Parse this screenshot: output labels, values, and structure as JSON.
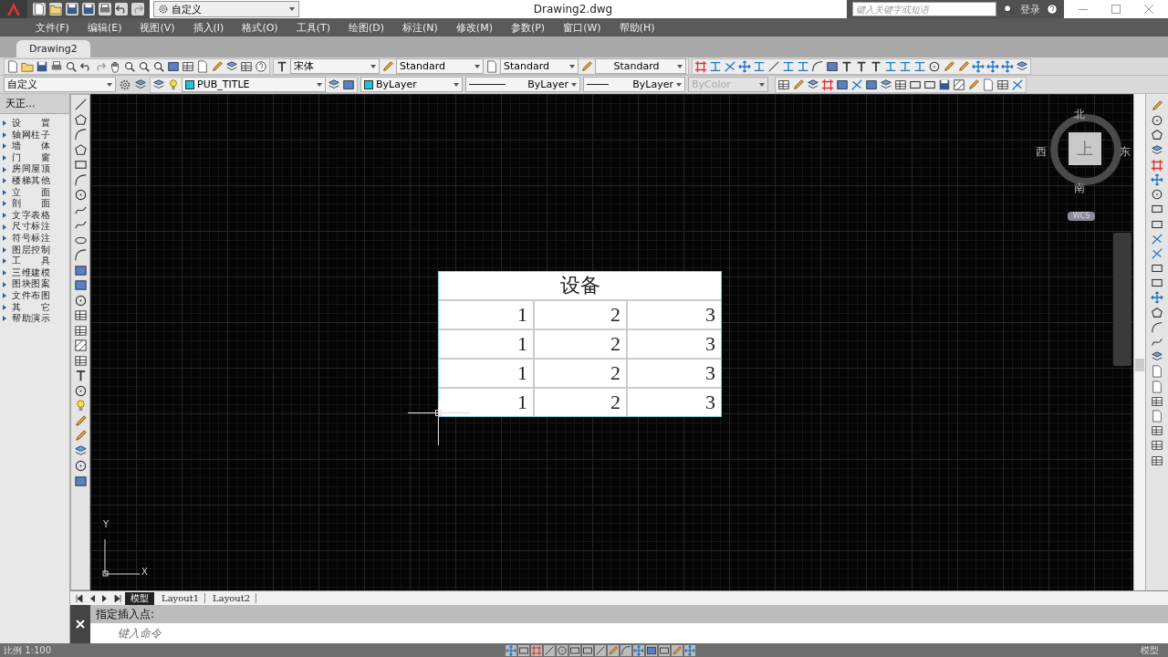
{
  "title_bar": {
    "workspace": "自定义",
    "title": "Drawing2.dwg",
    "search": {
      "placeholder": "键入关键字或短语"
    },
    "sign_in": "登录"
  },
  "menu": [
    "文件(F)",
    "编辑(E)",
    "视图(V)",
    "插入(I)",
    "格式(O)",
    "工具(T)",
    "绘图(D)",
    "标注(N)",
    "修改(M)",
    "参数(P)",
    "窗口(W)",
    "帮助(H)"
  ],
  "document_tabs": [
    {
      "label": "Drawing2",
      "selected": true
    }
  ],
  "toolbar": {
    "font": "宋体",
    "text_style": "Standard",
    "dim_style": "Standard",
    "table_style": "Standard"
  },
  "properties_bar": {
    "workspace": "自定义",
    "layer": "PUB_TITLE",
    "color_control": "ByLayer",
    "linetype": "ByLayer",
    "lineweight": "ByLayer",
    "plot_style": {
      "value": "ByColor",
      "disabled": true
    }
  },
  "tool_palette": {
    "title": "天正...",
    "items": [
      "设 置",
      "轴网柱子",
      "墙 体",
      "门 窗",
      "房间屋顶",
      "楼梯其他",
      "立 面",
      "剖 面",
      "文字表格",
      "尺寸标注",
      "符号标注",
      "图层控制",
      "工 具",
      "三维建模",
      "图块图案",
      "文件布图",
      "其 它",
      "帮助演示"
    ]
  },
  "canvas": {
    "table": {
      "title": "设备",
      "rows": [
        [
          "1",
          "2",
          "3"
        ],
        [
          "1",
          "2",
          "3"
        ],
        [
          "1",
          "2",
          "3"
        ],
        [
          "1",
          "2",
          "3"
        ]
      ]
    },
    "viewcube": {
      "north": "北",
      "south": "南",
      "east": "东",
      "west": "西",
      "face": "上",
      "ucs": "WCS"
    },
    "ucs_icon": {
      "x": "X",
      "y": "Y"
    }
  },
  "layout_tabs": [
    {
      "label": "模型",
      "selected": true
    },
    {
      "label": "Layout1",
      "selected": false
    },
    {
      "label": "Layout2",
      "selected": false
    }
  ],
  "command_line": {
    "history": "指定插入点:",
    "placeholder": "键入命令"
  },
  "status_bar": {
    "scale": "比例 1:100",
    "space": "模型"
  }
}
